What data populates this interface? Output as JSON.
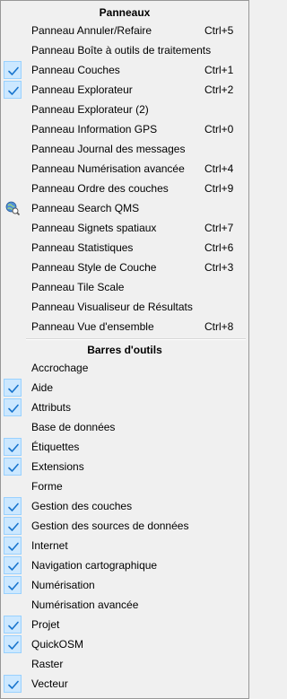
{
  "menu": {
    "panels_header": "Panneaux",
    "panels": [
      {
        "label": "Panneau Annuler/Refaire",
        "shortcut": "Ctrl+5",
        "checked": false
      },
      {
        "label": "Panneau Boîte à outils de traitements",
        "shortcut": "",
        "checked": false
      },
      {
        "label": "Panneau Couches",
        "shortcut": "Ctrl+1",
        "checked": true
      },
      {
        "label": "Panneau Explorateur",
        "shortcut": "Ctrl+2",
        "checked": true
      },
      {
        "label": "Panneau Explorateur (2)",
        "shortcut": "",
        "checked": false
      },
      {
        "label": "Panneau Information GPS",
        "shortcut": "Ctrl+0",
        "checked": false
      },
      {
        "label": "Panneau Journal des messages",
        "shortcut": "",
        "checked": false
      },
      {
        "label": "Panneau Numérisation avancée",
        "shortcut": "Ctrl+4",
        "checked": false
      },
      {
        "label": "Panneau Ordre des couches",
        "shortcut": "Ctrl+9",
        "checked": false
      },
      {
        "label": "Panneau Search QMS",
        "shortcut": "",
        "checked": false,
        "icon": "globe-search-icon"
      },
      {
        "label": "Panneau Signets spatiaux",
        "shortcut": "Ctrl+7",
        "checked": false
      },
      {
        "label": "Panneau Statistiques",
        "shortcut": "Ctrl+6",
        "checked": false
      },
      {
        "label": "Panneau Style de Couche",
        "shortcut": "Ctrl+3",
        "checked": false
      },
      {
        "label": "Panneau Tile Scale",
        "shortcut": "",
        "checked": false
      },
      {
        "label": "Panneau Visualiseur de Résultats",
        "shortcut": "",
        "checked": false
      },
      {
        "label": "Panneau Vue d'ensemble",
        "shortcut": "Ctrl+8",
        "checked": false
      }
    ],
    "toolbars_header": "Barres d'outils",
    "toolbars": [
      {
        "label": "Accrochage",
        "checked": false
      },
      {
        "label": "Aide",
        "checked": true
      },
      {
        "label": "Attributs",
        "checked": true
      },
      {
        "label": "Base de données",
        "checked": false
      },
      {
        "label": "Étiquettes",
        "checked": true
      },
      {
        "label": "Extensions",
        "checked": true
      },
      {
        "label": "Forme",
        "checked": false
      },
      {
        "label": "Gestion des couches",
        "checked": true
      },
      {
        "label": "Gestion des sources de données",
        "checked": true
      },
      {
        "label": "Internet",
        "checked": true
      },
      {
        "label": "Navigation cartographique",
        "checked": true
      },
      {
        "label": "Numérisation",
        "checked": true
      },
      {
        "label": "Numérisation avancée",
        "checked": false
      },
      {
        "label": "Projet",
        "checked": true
      },
      {
        "label": "QuickOSM",
        "checked": true
      },
      {
        "label": "Raster",
        "checked": false
      },
      {
        "label": "Vecteur",
        "checked": true
      }
    ],
    "colors": {
      "check_bg": "#cce8ff",
      "check_mark": "#1874cd",
      "background": "#f0f0f0"
    }
  }
}
